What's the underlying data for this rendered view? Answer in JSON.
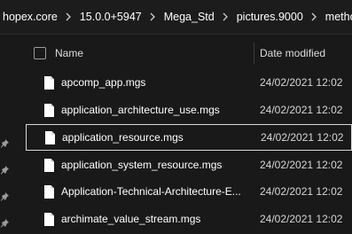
{
  "breadcrumb": [
    {
      "label": "hopex.core"
    },
    {
      "label": "15.0.0+5947"
    },
    {
      "label": "Mega_Std"
    },
    {
      "label": "pictures.9000"
    },
    {
      "label": "method"
    }
  ],
  "columns": {
    "name": "Name",
    "date_modified": "Date modified"
  },
  "files": [
    {
      "name": "apcomp_app.mgs",
      "date": "24/02/2021 12:02",
      "selected": false
    },
    {
      "name": "application_architecture_use.mgs",
      "date": "24/02/2021 12:02",
      "selected": false
    },
    {
      "name": "application_resource.mgs",
      "date": "24/02/2021 12:02",
      "selected": true
    },
    {
      "name": "application_system_resource.mgs",
      "date": "24/02/2021 12:02",
      "selected": false
    },
    {
      "name": "Application-Technical-Architecture-E...",
      "date": "24/02/2021 12:02",
      "selected": false
    },
    {
      "name": "archimate_value_stream.mgs",
      "date": "24/02/2021 12:02",
      "selected": false
    }
  ],
  "icons": {
    "file": "file-icon",
    "separator": "chevron-right-icon",
    "pin": "pin-icon"
  },
  "colors": {
    "background": "#191919",
    "text": "#ffffff",
    "date_text": "#d6d6d6",
    "selection_border": "#d8d8d8"
  }
}
